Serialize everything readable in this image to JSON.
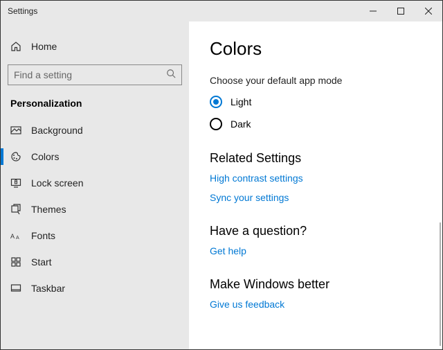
{
  "window": {
    "title": "Settings"
  },
  "sidebar": {
    "home_label": "Home",
    "search_placeholder": "Find a setting",
    "section_title": "Personalization",
    "items": [
      {
        "label": "Background"
      },
      {
        "label": "Colors"
      },
      {
        "label": "Lock screen"
      },
      {
        "label": "Themes"
      },
      {
        "label": "Fonts"
      },
      {
        "label": "Start"
      },
      {
        "label": "Taskbar"
      }
    ]
  },
  "content": {
    "heading": "Colors",
    "mode_prompt": "Choose your default app mode",
    "mode_options": {
      "light": "Light",
      "dark": "Dark"
    },
    "related": {
      "heading": "Related Settings",
      "links": {
        "high_contrast": "High contrast settings",
        "sync": "Sync your settings"
      }
    },
    "question": {
      "heading": "Have a question?",
      "link": "Get help"
    },
    "feedback": {
      "heading": "Make Windows better",
      "link": "Give us feedback"
    }
  }
}
